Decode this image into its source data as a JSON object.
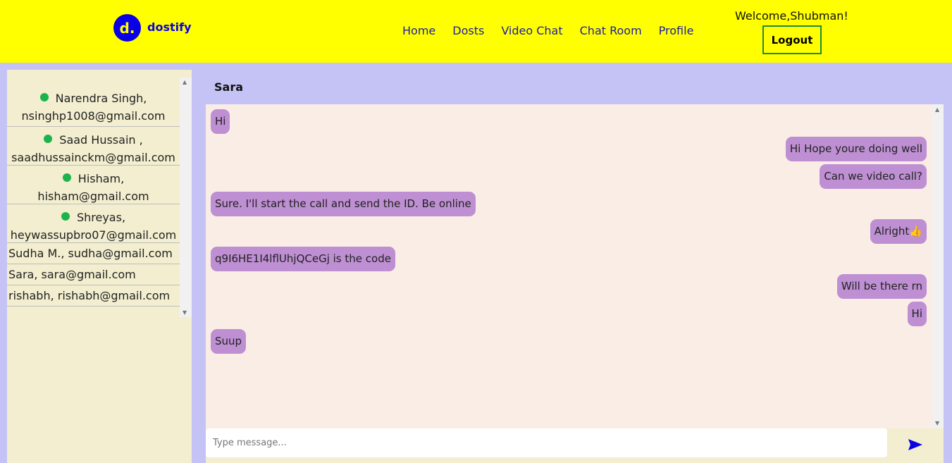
{
  "brand": {
    "logo_letter": "d.",
    "name": "dostify",
    "color": "#0a00e6"
  },
  "nav": [
    {
      "label": "Home"
    },
    {
      "label": "Dosts"
    },
    {
      "label": "Video Chat"
    },
    {
      "label": "Chat Room"
    },
    {
      "label": "Profile"
    }
  ],
  "welcome_text": "Welcome,Shubman!",
  "logout_label": "Logout",
  "contacts": [
    {
      "name": "Narendra Singh,",
      "email": "nsinghp1008@gmail.com",
      "online": true
    },
    {
      "name": "Saad Hussain ,",
      "email": "saadhussainckm@gmail.com",
      "online": true
    },
    {
      "name": "Hisham,",
      "email": "hisham@gmail.com",
      "online": true
    },
    {
      "name": "Shreyas,",
      "email": "heywassupbro07@gmail.com",
      "online": true
    },
    {
      "text": "Sudha M., sudha@gmail.com",
      "online": false
    },
    {
      "text": "Sara, sara@gmail.com",
      "online": false
    },
    {
      "text": "rishabh, rishabh@gmail.com",
      "online": false
    }
  ],
  "chat": {
    "title": "Sara",
    "messages": [
      {
        "text": "Hi",
        "direction": "in"
      },
      {
        "text": "Hi Hope youre doing well",
        "direction": "out"
      },
      {
        "text": "Can we video call?",
        "direction": "out"
      },
      {
        "text": "Sure. I'll start the call and send the ID. Be online",
        "direction": "in"
      },
      {
        "text": "Alright👍",
        "direction": "out"
      },
      {
        "text": "q9I6HE1I4lflUhjQCeGj is the code",
        "direction": "in"
      },
      {
        "text": "Will be there rn",
        "direction": "out"
      },
      {
        "text": "Hi",
        "direction": "out"
      },
      {
        "text": "Suup",
        "direction": "in"
      }
    ],
    "input_placeholder": "Type message...",
    "input_value": ""
  },
  "colors": {
    "header_bg": "#ffff00",
    "page_bg": "#c5c3f5",
    "sidebar_bg": "#f2eecf",
    "chat_bg": "#faede6",
    "bubble": "#be8fd2",
    "online_dot": "#1db34c",
    "send_icon": "#0a00e6"
  }
}
